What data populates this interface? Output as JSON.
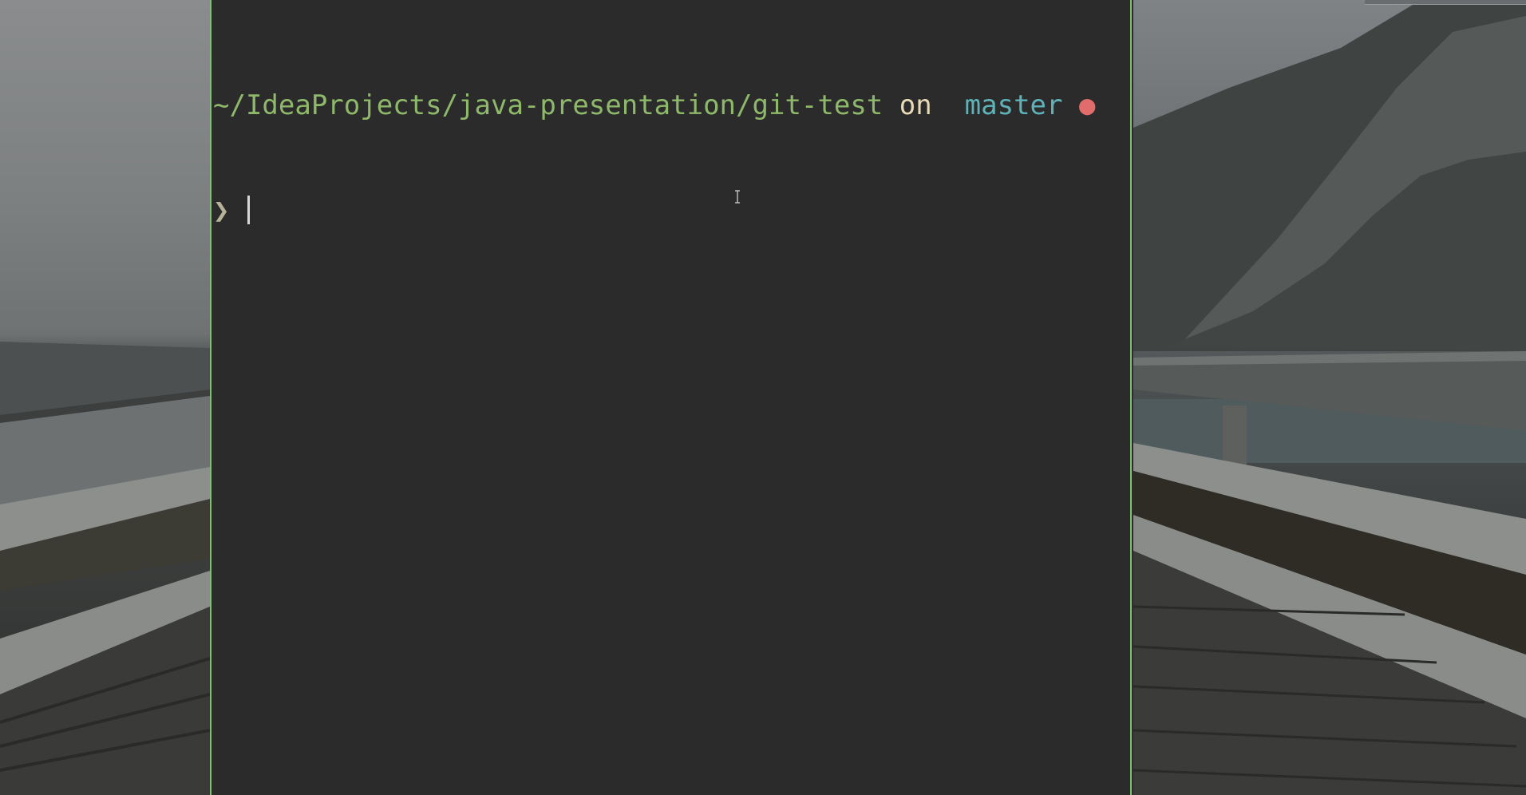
{
  "terminal": {
    "path": "~/IdeaProjects/java-presentation/git-test",
    "on_word": "on",
    "branch_icon": "",
    "branch_name": "master",
    "dirty_indicator": "●",
    "prompt_symbol": "❯"
  },
  "icons": {
    "branch": "git-branch-icon",
    "dirty": "dirty-status-dot-icon",
    "mouse": "i-beam-cursor-icon"
  },
  "colors": {
    "window_border": "#7cc36b",
    "terminal_bg": "#2b2b2b",
    "path": "#8fb96a",
    "branch": "#5fb3b8",
    "dirty": "#e06c6c"
  }
}
